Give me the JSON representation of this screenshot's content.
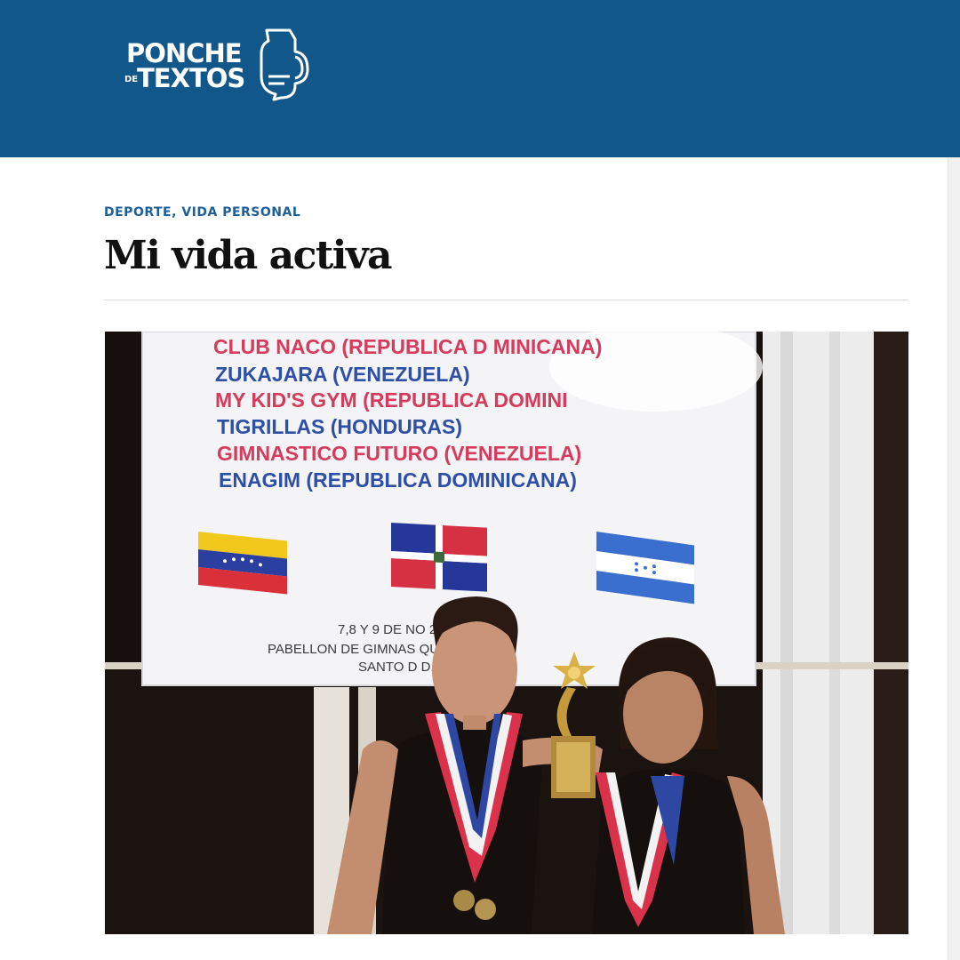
{
  "site": {
    "logo_line1": "PONCHE",
    "logo_small": "DE",
    "logo_line2": "TEXTOS",
    "logo_icon": "pitcher-speech-bubble-icon",
    "header_color": "#12578a"
  },
  "article": {
    "categories": [
      "DEPORTE",
      "VIDA PERSONAL"
    ],
    "category_separator": ", ",
    "title": "Mi vida activa"
  },
  "photo": {
    "banner_lines": [
      "CLUB NACO (REPUBLICA D  MINICANA)",
      "ZUKAJARA (VENEZUELA)",
      "MY KID'S GYM (REPUBLICA DOMINI",
      "TIGRILLAS (HONDURAS)",
      "GIMNASTICO FUTURO (VENEZUELA)",
      "ENAGIM (REPUBLICA DOMINICANA)"
    ],
    "banner_footer": [
      "7,8 Y 9 DE NO          2008",
      "PABELLON DE GIMNAS          QUE DEL ESTE",
      "SANTO D           D."
    ],
    "flags": [
      "venezuela-flag",
      "dominican-republic-flag",
      "honduras-flag"
    ],
    "banner_colors": {
      "red": "#d63a5c",
      "blue": "#2d4fa6"
    }
  }
}
